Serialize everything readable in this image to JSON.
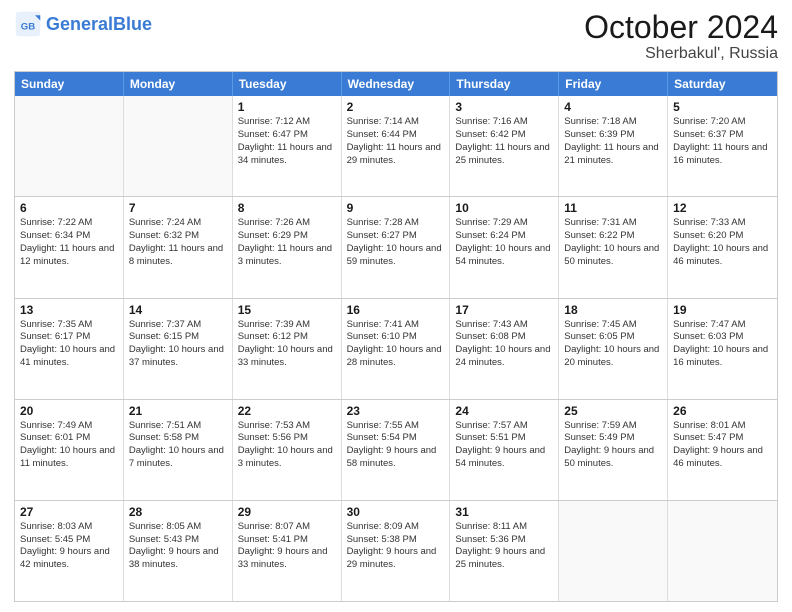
{
  "header": {
    "logo_general": "General",
    "logo_blue": "Blue",
    "main_title": "October 2024",
    "subtitle": "Sherbakul', Russia"
  },
  "calendar": {
    "days": [
      "Sunday",
      "Monday",
      "Tuesday",
      "Wednesday",
      "Thursday",
      "Friday",
      "Saturday"
    ],
    "rows": [
      [
        {
          "day": "",
          "empty": true
        },
        {
          "day": "",
          "empty": true
        },
        {
          "day": "1",
          "sunrise": "Sunrise: 7:12 AM",
          "sunset": "Sunset: 6:47 PM",
          "daylight": "Daylight: 11 hours and 34 minutes."
        },
        {
          "day": "2",
          "sunrise": "Sunrise: 7:14 AM",
          "sunset": "Sunset: 6:44 PM",
          "daylight": "Daylight: 11 hours and 29 minutes."
        },
        {
          "day": "3",
          "sunrise": "Sunrise: 7:16 AM",
          "sunset": "Sunset: 6:42 PM",
          "daylight": "Daylight: 11 hours and 25 minutes."
        },
        {
          "day": "4",
          "sunrise": "Sunrise: 7:18 AM",
          "sunset": "Sunset: 6:39 PM",
          "daylight": "Daylight: 11 hours and 21 minutes."
        },
        {
          "day": "5",
          "sunrise": "Sunrise: 7:20 AM",
          "sunset": "Sunset: 6:37 PM",
          "daylight": "Daylight: 11 hours and 16 minutes."
        }
      ],
      [
        {
          "day": "6",
          "sunrise": "Sunrise: 7:22 AM",
          "sunset": "Sunset: 6:34 PM",
          "daylight": "Daylight: 11 hours and 12 minutes."
        },
        {
          "day": "7",
          "sunrise": "Sunrise: 7:24 AM",
          "sunset": "Sunset: 6:32 PM",
          "daylight": "Daylight: 11 hours and 8 minutes."
        },
        {
          "day": "8",
          "sunrise": "Sunrise: 7:26 AM",
          "sunset": "Sunset: 6:29 PM",
          "daylight": "Daylight: 11 hours and 3 minutes."
        },
        {
          "day": "9",
          "sunrise": "Sunrise: 7:28 AM",
          "sunset": "Sunset: 6:27 PM",
          "daylight": "Daylight: 10 hours and 59 minutes."
        },
        {
          "day": "10",
          "sunrise": "Sunrise: 7:29 AM",
          "sunset": "Sunset: 6:24 PM",
          "daylight": "Daylight: 10 hours and 54 minutes."
        },
        {
          "day": "11",
          "sunrise": "Sunrise: 7:31 AM",
          "sunset": "Sunset: 6:22 PM",
          "daylight": "Daylight: 10 hours and 50 minutes."
        },
        {
          "day": "12",
          "sunrise": "Sunrise: 7:33 AM",
          "sunset": "Sunset: 6:20 PM",
          "daylight": "Daylight: 10 hours and 46 minutes."
        }
      ],
      [
        {
          "day": "13",
          "sunrise": "Sunrise: 7:35 AM",
          "sunset": "Sunset: 6:17 PM",
          "daylight": "Daylight: 10 hours and 41 minutes."
        },
        {
          "day": "14",
          "sunrise": "Sunrise: 7:37 AM",
          "sunset": "Sunset: 6:15 PM",
          "daylight": "Daylight: 10 hours and 37 minutes."
        },
        {
          "day": "15",
          "sunrise": "Sunrise: 7:39 AM",
          "sunset": "Sunset: 6:12 PM",
          "daylight": "Daylight: 10 hours and 33 minutes."
        },
        {
          "day": "16",
          "sunrise": "Sunrise: 7:41 AM",
          "sunset": "Sunset: 6:10 PM",
          "daylight": "Daylight: 10 hours and 28 minutes."
        },
        {
          "day": "17",
          "sunrise": "Sunrise: 7:43 AM",
          "sunset": "Sunset: 6:08 PM",
          "daylight": "Daylight: 10 hours and 24 minutes."
        },
        {
          "day": "18",
          "sunrise": "Sunrise: 7:45 AM",
          "sunset": "Sunset: 6:05 PM",
          "daylight": "Daylight: 10 hours and 20 minutes."
        },
        {
          "day": "19",
          "sunrise": "Sunrise: 7:47 AM",
          "sunset": "Sunset: 6:03 PM",
          "daylight": "Daylight: 10 hours and 16 minutes."
        }
      ],
      [
        {
          "day": "20",
          "sunrise": "Sunrise: 7:49 AM",
          "sunset": "Sunset: 6:01 PM",
          "daylight": "Daylight: 10 hours and 11 minutes."
        },
        {
          "day": "21",
          "sunrise": "Sunrise: 7:51 AM",
          "sunset": "Sunset: 5:58 PM",
          "daylight": "Daylight: 10 hours and 7 minutes."
        },
        {
          "day": "22",
          "sunrise": "Sunrise: 7:53 AM",
          "sunset": "Sunset: 5:56 PM",
          "daylight": "Daylight: 10 hours and 3 minutes."
        },
        {
          "day": "23",
          "sunrise": "Sunrise: 7:55 AM",
          "sunset": "Sunset: 5:54 PM",
          "daylight": "Daylight: 9 hours and 58 minutes."
        },
        {
          "day": "24",
          "sunrise": "Sunrise: 7:57 AM",
          "sunset": "Sunset: 5:51 PM",
          "daylight": "Daylight: 9 hours and 54 minutes."
        },
        {
          "day": "25",
          "sunrise": "Sunrise: 7:59 AM",
          "sunset": "Sunset: 5:49 PM",
          "daylight": "Daylight: 9 hours and 50 minutes."
        },
        {
          "day": "26",
          "sunrise": "Sunrise: 8:01 AM",
          "sunset": "Sunset: 5:47 PM",
          "daylight": "Daylight: 9 hours and 46 minutes."
        }
      ],
      [
        {
          "day": "27",
          "sunrise": "Sunrise: 8:03 AM",
          "sunset": "Sunset: 5:45 PM",
          "daylight": "Daylight: 9 hours and 42 minutes."
        },
        {
          "day": "28",
          "sunrise": "Sunrise: 8:05 AM",
          "sunset": "Sunset: 5:43 PM",
          "daylight": "Daylight: 9 hours and 38 minutes."
        },
        {
          "day": "29",
          "sunrise": "Sunrise: 8:07 AM",
          "sunset": "Sunset: 5:41 PM",
          "daylight": "Daylight: 9 hours and 33 minutes."
        },
        {
          "day": "30",
          "sunrise": "Sunrise: 8:09 AM",
          "sunset": "Sunset: 5:38 PM",
          "daylight": "Daylight: 9 hours and 29 minutes."
        },
        {
          "day": "31",
          "sunrise": "Sunrise: 8:11 AM",
          "sunset": "Sunset: 5:36 PM",
          "daylight": "Daylight: 9 hours and 25 minutes."
        },
        {
          "day": "",
          "empty": true
        },
        {
          "day": "",
          "empty": true
        }
      ]
    ]
  }
}
